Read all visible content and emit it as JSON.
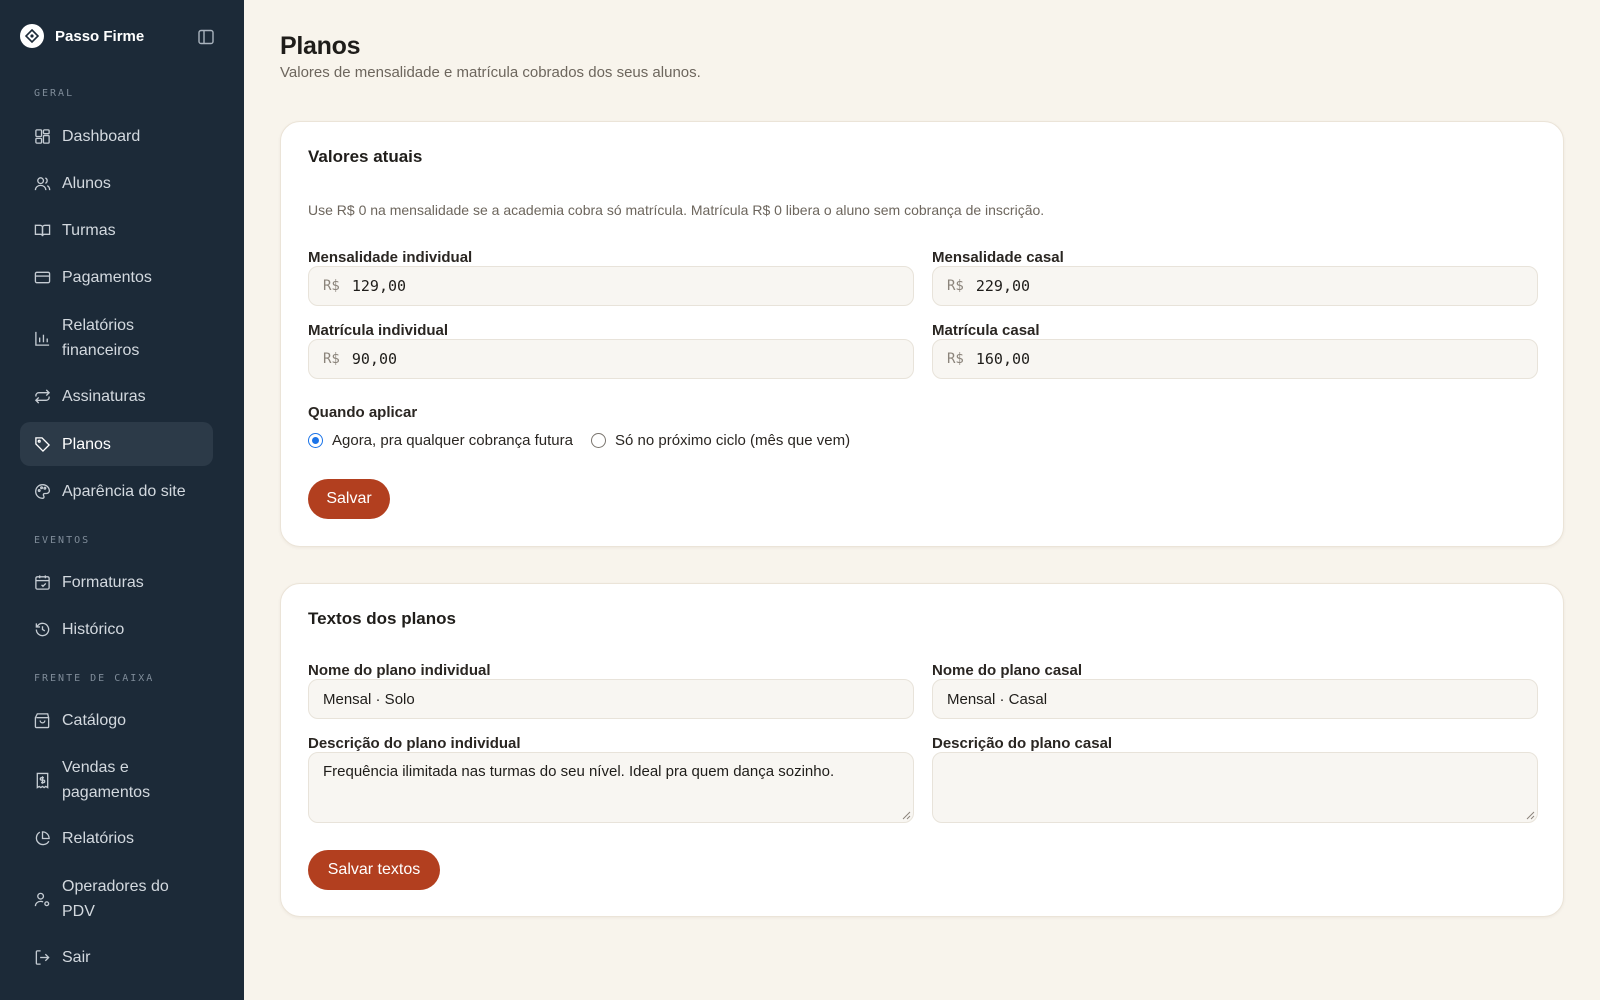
{
  "app": {
    "name": "Passo Firme"
  },
  "sidebar": {
    "sections": [
      {
        "label": "GERAL"
      },
      {
        "label": "EVENTOS"
      },
      {
        "label": "FRENTE DE CAIXA"
      }
    ],
    "items": [
      {
        "label": "Dashboard",
        "icon": "layout-dashboard-icon"
      },
      {
        "label": "Alunos",
        "icon": "users-icon"
      },
      {
        "label": "Turmas",
        "icon": "book-open-icon"
      },
      {
        "label": "Pagamentos",
        "icon": "credit-card-icon"
      },
      {
        "label": "Relatórios financeiros",
        "icon": "bar-chart-icon"
      },
      {
        "label": "Assinaturas",
        "icon": "repeat-icon"
      },
      {
        "label": "Planos",
        "icon": "tag-icon",
        "active": true
      },
      {
        "label": "Aparência do site",
        "icon": "palette-icon"
      },
      {
        "label": "Formaturas",
        "icon": "calendar-icon"
      },
      {
        "label": "Histórico",
        "icon": "history-icon"
      },
      {
        "label": "Catálogo",
        "icon": "shopping-bag-icon"
      },
      {
        "label": "Vendas e pagamentos",
        "icon": "receipt-icon"
      },
      {
        "label": "Relatórios",
        "icon": "pie-chart-icon"
      },
      {
        "label": "Operadores do PDV",
        "icon": "user-cog-icon"
      },
      {
        "label": "Sair",
        "icon": "log-out-icon"
      }
    ]
  },
  "page": {
    "title": "Planos",
    "subtitle": "Valores de mensalidade e matrícula cobrados dos seus alunos."
  },
  "values_card": {
    "title": "Valores atuais",
    "hint": "Use R$ 0 na mensalidade se a academia cobra só matrícula. Matrícula R$ 0 libera o aluno sem cobrança de inscrição.",
    "currency_prefix": "R$",
    "fields": {
      "mensalidade_individual": {
        "label": "Mensalidade individual",
        "value": "129,00"
      },
      "mensalidade_casal": {
        "label": "Mensalidade casal",
        "value": "229,00"
      },
      "matricula_individual": {
        "label": "Matrícula individual",
        "value": "90,00"
      },
      "matricula_casal": {
        "label": "Matrícula casal",
        "value": "160,00"
      }
    },
    "apply_label": "Quando aplicar",
    "apply_options": [
      {
        "label": "Agora, pra qualquer cobrança futura",
        "checked": true
      },
      {
        "label": "Só no próximo ciclo (mês que vem)",
        "checked": false
      }
    ],
    "save_label": "Salvar"
  },
  "texts_card": {
    "title": "Textos dos planos",
    "fields": {
      "nome_individual": {
        "label": "Nome do plano individual",
        "value": "Mensal · Solo"
      },
      "nome_casal": {
        "label": "Nome do plano casal",
        "value": "Mensal · Casal"
      },
      "descricao_individual": {
        "label": "Descrição do plano individual",
        "value": "Frequência ilimitada nas turmas do seu nível. Ideal pra quem dança sozinho."
      },
      "descricao_casal": {
        "label": "Descrição do plano casal",
        "value": ""
      }
    },
    "save_label": "Salvar textos"
  },
  "colors": {
    "sidebar_bg": "#1c2a38",
    "page_bg": "#f8f4ec",
    "accent": "#b23f1f",
    "radio_selected": "#1a73e8"
  }
}
